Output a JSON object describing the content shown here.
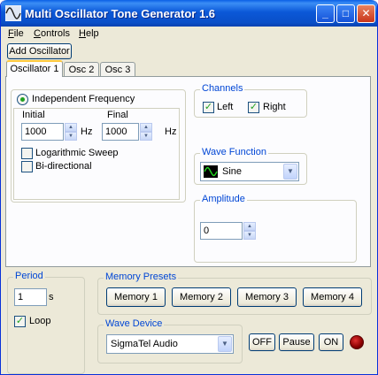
{
  "window": {
    "title": "Multi Oscillator Tone Generator 1.6"
  },
  "title_buttons": {
    "minimize": "_",
    "maximize": "□",
    "close": "✕"
  },
  "menu": [
    {
      "label": "File",
      "key": "F",
      "rest": "ile"
    },
    {
      "label": "Controls",
      "key": "C",
      "rest": "ontrols"
    },
    {
      "label": "Help",
      "key": "H",
      "rest": "elp"
    }
  ],
  "toolbar": {
    "add_oscillator": "Add Oscillator"
  },
  "tabs": [
    "Oscillator 1",
    "Osc 2",
    "Osc 3"
  ],
  "frequency": {
    "mode_label": "Independent Frequency",
    "initial_label": "Initial",
    "final_label": "Final",
    "initial_value": "1000",
    "final_value": "1000",
    "unit": "Hz",
    "log_sweep_label": "Logarithmic Sweep",
    "bidirectional_label": "Bi-directional"
  },
  "channels": {
    "label": "Channels",
    "left": "Left",
    "right": "Right"
  },
  "wave_function": {
    "label": "Wave Function",
    "selected": "Sine"
  },
  "amplitude": {
    "label": "Amplitude",
    "value": "0"
  },
  "period": {
    "label": "Period",
    "value": "1",
    "unit": "s",
    "loop_label": "Loop"
  },
  "memory_presets": {
    "label": "Memory Presets",
    "buttons": [
      "Memory 1",
      "Memory 2",
      "Memory 3",
      "Memory 4"
    ]
  },
  "wave_device": {
    "label": "Wave Device",
    "selected": "SigmaTel Audio"
  },
  "controls": {
    "off": "OFF",
    "pause": "Pause",
    "on": "ON"
  },
  "colors": {
    "group_label": "#0046d5",
    "titlebar": "#0a4fc8",
    "led": "#8a0000",
    "check": "#21a121"
  }
}
